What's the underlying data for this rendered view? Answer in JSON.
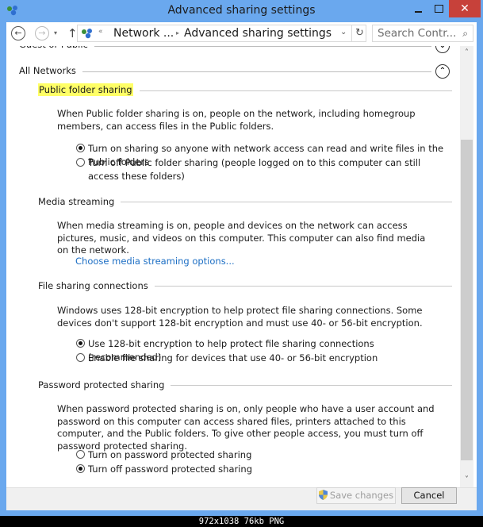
{
  "window": {
    "title": "Advanced sharing settings",
    "icon": "network-sharing-icon",
    "controls": {
      "minimize": "minimize-icon",
      "maximize": "maximize-icon",
      "close": "✕"
    }
  },
  "navigation": {
    "back": "←",
    "forward": "→",
    "recent": "▾",
    "up": "↑",
    "address": {
      "overflow": "«",
      "crumbs": [
        "Network ...",
        "Advanced sharing settings"
      ],
      "separator": "▸",
      "dropdown": "⌄",
      "refresh": "↻"
    },
    "search": {
      "placeholder": "Search Contr...",
      "value": "",
      "icon": "⌕"
    }
  },
  "profiles": [
    {
      "label": "Guest or Public",
      "expanded": false,
      "toggle": "⌄"
    },
    {
      "label": "All Networks",
      "expanded": true,
      "toggle": "⌃"
    }
  ],
  "sections": {
    "public_folder": {
      "heading": "Public folder sharing",
      "highlighted": true,
      "description": "When Public folder sharing is on, people on the network, including homegroup members, can access files in the Public folders.",
      "options": [
        {
          "label": "Turn on sharing so anyone with network access can read and write files in the Public folders",
          "selected": true
        },
        {
          "label": "Turn off Public folder sharing (people logged on to this computer can still access these folders)",
          "selected": false
        }
      ]
    },
    "media_streaming": {
      "heading": "Media streaming",
      "description": "When media streaming is on, people and devices on the network can access pictures, music, and videos on this computer. This computer can also find media on the network.",
      "link": "Choose media streaming options..."
    },
    "file_sharing": {
      "heading": "File sharing connections",
      "description": "Windows uses 128-bit encryption to help protect file sharing connections. Some devices don't support 128-bit encryption and must use 40- or 56-bit encryption.",
      "options": [
        {
          "label": "Use 128-bit encryption to help protect file sharing connections (recommended)",
          "selected": true
        },
        {
          "label": "Enable file sharing for devices that use 40- or 56-bit encryption",
          "selected": false
        }
      ]
    },
    "password": {
      "heading": "Password protected sharing",
      "description": "When password protected sharing is on, only people who have a user account and password on this computer can access shared files, printers attached to this computer, and the Public folders. To give other people access, you must turn off password protected sharing.",
      "options": [
        {
          "label": "Turn on password protected sharing",
          "selected": false
        },
        {
          "label": "Turn off password protected sharing",
          "selected": true
        }
      ]
    }
  },
  "scrollbar": {
    "up": "˄",
    "down": "˅",
    "position_fraction": 0.27
  },
  "footer": {
    "save_label": "Save changes",
    "save_enabled": false,
    "cancel_label": "Cancel"
  },
  "image_info": "972x1038 76kb PNG",
  "colors": {
    "frame": "#6aa8ee",
    "close": "#c7413a",
    "link": "#1c6ec4",
    "highlight": "#ffff66"
  }
}
